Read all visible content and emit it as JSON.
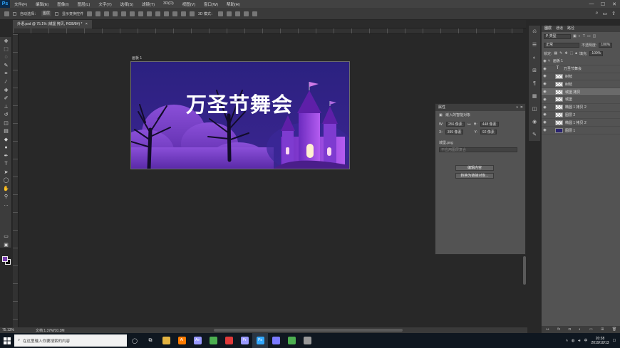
{
  "app": {
    "logo": "Ps"
  },
  "menu": [
    "文件(F)",
    "编辑(E)",
    "图像(I)",
    "图层(L)",
    "文字(Y)",
    "选择(S)",
    "滤镜(T)",
    "3D(D)",
    "视图(V)",
    "窗口(W)",
    "帮助(H)"
  ],
  "window_controls": [
    "—",
    "☐",
    "✕"
  ],
  "options": {
    "auto_select_label": "自动选择：",
    "auto_select_value": "图层",
    "show_transform_label": "显示变换控件",
    "mode_3d_label": "3D 模式："
  },
  "document": {
    "tab": "外语.psd @ 75.1% (城堡 拷贝, RGB/8#) *",
    "artboard_label": "画板 1"
  },
  "banner": {
    "title": "万圣节舞会"
  },
  "properties": {
    "title": "属性",
    "type": "嵌入的智能对象",
    "w_label": "W:",
    "w_value": "256 像素",
    "h_label": "H:",
    "h_value": "448 像素",
    "x_label": "X:",
    "x_value": "399 像素",
    "y_label": "Y:",
    "y_value": "92 像素",
    "file": "城堡.png",
    "comp_placeholder": "不应用图层复合",
    "edit_button": "编辑内容",
    "convert_button": "转换为链接对象..."
  },
  "layers_panel": {
    "tabs": [
      "图层",
      "通道",
      "路径"
    ],
    "filter": "P 类型",
    "blend_mode": "正常",
    "opacity_label": "不透明度:",
    "opacity": "100%",
    "lock_label": "锁定:",
    "fill_label": "填充:",
    "fill": "100%",
    "layers": [
      {
        "name": "画板 1",
        "kind": "group"
      },
      {
        "name": "万圣节舞会",
        "kind": "text"
      },
      {
        "name": "树枝",
        "kind": "image"
      },
      {
        "name": "树枝",
        "kind": "image"
      },
      {
        "name": "城堡 拷贝",
        "kind": "image",
        "selected": true
      },
      {
        "name": "城堡",
        "kind": "image"
      },
      {
        "name": "椭圆 1 拷贝 2",
        "kind": "shape"
      },
      {
        "name": "图层 2",
        "kind": "image"
      },
      {
        "name": "椭圆 1 拷贝 2",
        "kind": "shape"
      },
      {
        "name": "图层 1",
        "kind": "fill"
      }
    ],
    "colors": {
      "fill_thumb": "#2a2370"
    }
  },
  "status": {
    "zoom": "75.13%",
    "doc": "文档:1.37M/10.3M"
  },
  "taskbar": {
    "search_placeholder": "在这里输入你要搜索的内容",
    "apps": [
      {
        "name": "explorer",
        "label": "",
        "color": "#e3b341"
      },
      {
        "name": "illustrator",
        "label": "Ai",
        "color": "#ff7c00"
      },
      {
        "name": "after-effects",
        "label": "Ae",
        "color": "#9999ff"
      },
      {
        "name": "chrome",
        "label": "",
        "color": "#4caf50"
      },
      {
        "name": "app-red",
        "label": "",
        "color": "#e03a3a"
      },
      {
        "name": "premiere",
        "label": "Pr",
        "color": "#9999ff"
      },
      {
        "name": "photoshop",
        "label": "Ps",
        "color": "#31a8ff"
      },
      {
        "name": "app-circle",
        "label": "",
        "color": "#7a7aff"
      },
      {
        "name": "chrome-2",
        "label": "",
        "color": "#4caf50"
      },
      {
        "name": "app-grey",
        "label": "",
        "color": "#999999"
      }
    ],
    "time": "20:38",
    "date": "2019/10/13"
  }
}
